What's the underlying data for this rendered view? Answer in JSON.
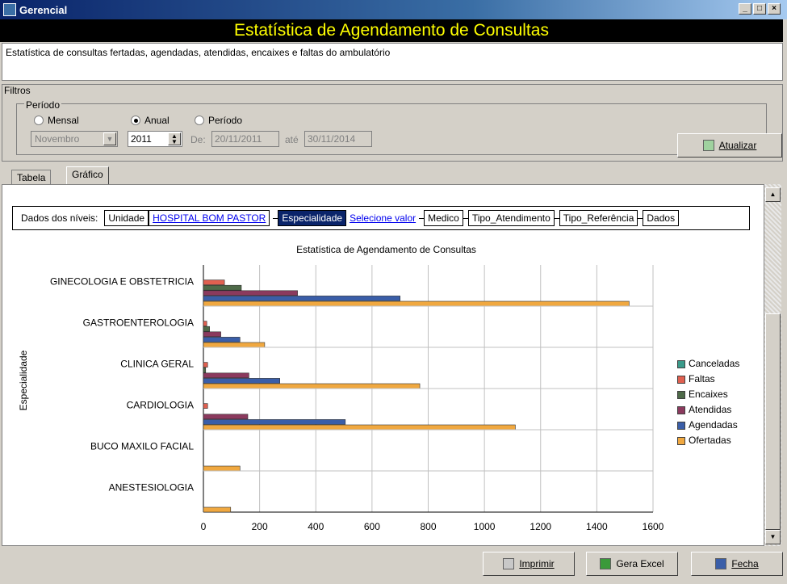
{
  "window": {
    "title": "Gerencial"
  },
  "header": {
    "title": "Estatística de Agendamento de Consultas"
  },
  "description": "Estatística de consultas fertadas, agendadas, atendidas, encaixes e faltas do ambulatório",
  "filters": {
    "group_label": "Filtros",
    "period_group_label": "Período",
    "options": [
      {
        "label": "Mensal",
        "selected": false
      },
      {
        "label": "Anual",
        "selected": true
      },
      {
        "label": "Período",
        "selected": false
      }
    ],
    "month_value": "Novembro",
    "year_value": "2011",
    "from_label": "De:",
    "from_value": "20/11/2011",
    "to_label": "até",
    "to_value": "30/11/2014",
    "update_button": "Atualizar"
  },
  "tabs": [
    {
      "label": "Tabela",
      "active": false
    },
    {
      "label": "Gráfico",
      "active": true
    }
  ],
  "levels": {
    "label": "Dados dos níveis:",
    "items": [
      {
        "label": "Unidade",
        "value": "HOSPITAL BOM PASTOR"
      },
      {
        "label": "Especialidade",
        "value": "Selecione valor"
      },
      {
        "label": "Medico"
      },
      {
        "label": "Tipo_Atendimento"
      },
      {
        "label": "Tipo_Referência"
      },
      {
        "label": "Dados"
      }
    ]
  },
  "chart_data": {
    "type": "bar",
    "orientation": "horizontal",
    "title": "Estatística de Agendamento de Consultas",
    "ylabel": "Especialidade",
    "xlabel": "",
    "xlim": [
      0,
      1600
    ],
    "xticks": [
      0,
      200,
      400,
      600,
      800,
      1000,
      1200,
      1400,
      1600
    ],
    "grid": true,
    "legend_position": "right",
    "categories": [
      "GINECOLOGIA E OBSTETRICIA",
      "GASTROENTEROLOGIA",
      "CLINICA GERAL",
      "CARDIOLOGIA",
      "BUCO MAXILO FACIAL",
      "ANESTESIOLOGIA"
    ],
    "series": [
      {
        "name": "Canceladas",
        "color": "#3a9a8a",
        "values": [
          0,
          0,
          0,
          0,
          0,
          0
        ]
      },
      {
        "name": "Faltas",
        "color": "#e06050",
        "values": [
          75,
          12,
          15,
          15,
          0,
          0
        ]
      },
      {
        "name": "Encaixes",
        "color": "#4e6a48",
        "values": [
          135,
          22,
          8,
          0,
          0,
          0
        ]
      },
      {
        "name": "Atendidas",
        "color": "#8b3a5e",
        "values": [
          335,
          62,
          162,
          158,
          0,
          0
        ]
      },
      {
        "name": "Agendadas",
        "color": "#3a5ea8",
        "values": [
          700,
          130,
          272,
          505,
          0,
          0
        ]
      },
      {
        "name": "Ofertadas",
        "color": "#f0a840",
        "values": [
          1515,
          218,
          770,
          1110,
          130,
          97
        ]
      }
    ]
  },
  "footer": {
    "print_button": "Imprimir",
    "excel_button": "Gera Excel",
    "close_button": "Fecha"
  }
}
